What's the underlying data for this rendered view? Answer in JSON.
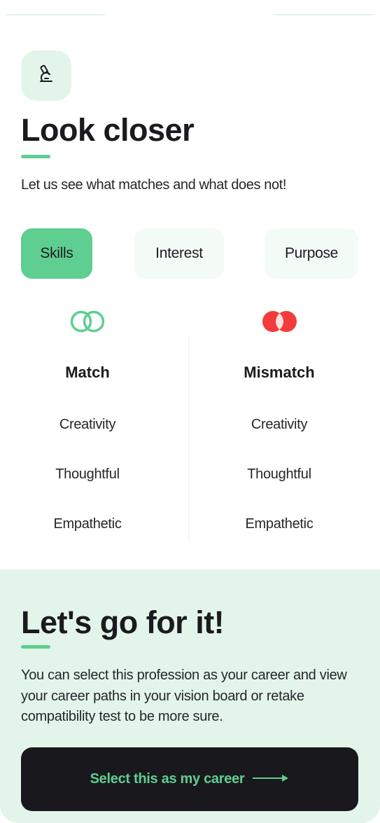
{
  "header": {
    "icon": "microscope-icon",
    "title": "Look closer",
    "subtitle": "Let us see what matches and what does not!"
  },
  "tabs": [
    {
      "label": "Skills",
      "active": true
    },
    {
      "label": "Interest",
      "active": false
    },
    {
      "label": "Purpose",
      "active": false
    }
  ],
  "comparison": {
    "match": {
      "icon": "overlapping-circles-outline-icon",
      "title": "Match",
      "items": [
        "Creativity",
        "Thoughtful",
        "Empathetic"
      ]
    },
    "mismatch": {
      "icon": "overlapping-circles-filled-icon",
      "title": "Mismatch",
      "items": [
        "Creativity",
        "Thoughtful",
        "Empathetic"
      ]
    }
  },
  "cta": {
    "title": "Let's go for it!",
    "description": "You can select this profession as your career and view your career paths in your vision board or retake compatibility test to be more sure.",
    "button_label": "Select this as my career",
    "button_icon": "arrow-right-icon"
  },
  "colors": {
    "accent": "#5fce91",
    "mint_bg": "#e3f5ea",
    "mismatch": "#f23b3b",
    "dark": "#19191d"
  }
}
